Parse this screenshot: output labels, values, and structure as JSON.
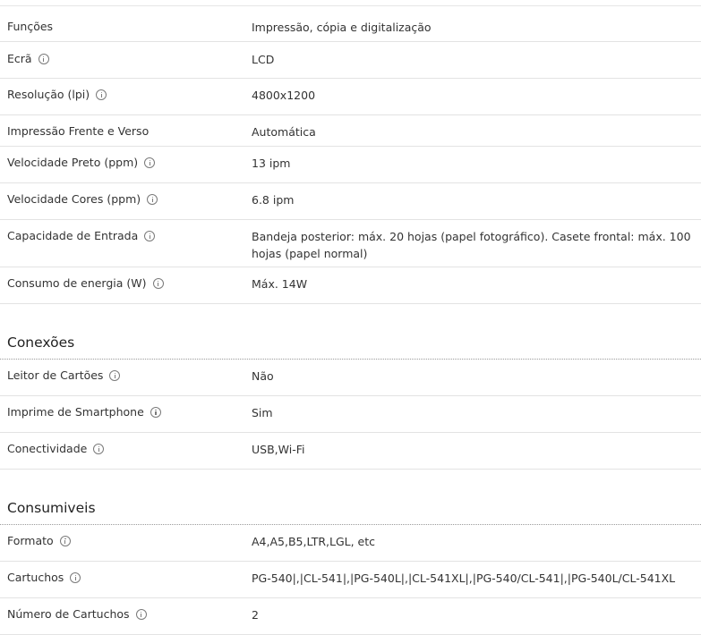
{
  "sections": [
    {
      "title": "",
      "rows": [
        {
          "label": "Funções",
          "value": "Impressão, cópia e digitalização",
          "info": false
        },
        {
          "label": "Ecrã",
          "value": "LCD",
          "info": true
        },
        {
          "label": "Resolução (lpi)",
          "value": "4800x1200",
          "info": true
        },
        {
          "label": "Impressão Frente e Verso",
          "value": "Automática",
          "info": false
        },
        {
          "label": "Velocidade Preto (ppm)",
          "value": "13 ipm",
          "info": true
        },
        {
          "label": "Velocidade Cores (ppm)",
          "value": "6.8 ipm",
          "info": true
        },
        {
          "label": "Capacidade de Entrada",
          "value": "Bandeja posterior: máx. 20 hojas (papel fotográfico). Casete frontal: máx. 100 hojas (papel normal)",
          "info": true
        },
        {
          "label": "Consumo de energia (W)",
          "value": "Máx. 14W",
          "info": true
        }
      ]
    },
    {
      "title": "Conexões",
      "rows": [
        {
          "label": "Leitor de Cartões",
          "value": "Não",
          "info": true
        },
        {
          "label": "Imprime de Smartphone",
          "value": "Sim",
          "info": true
        },
        {
          "label": "Conectividade",
          "value": "USB,Wi-Fi",
          "info": true
        }
      ]
    },
    {
      "title": "Consumiveis",
      "rows": [
        {
          "label": "Formato",
          "value": "A4,A5,B5,LTR,LGL, etc",
          "info": true
        },
        {
          "label": "Cartuchos",
          "value": "PG-540|,|CL-541|,|PG-540L|,|CL-541XL|,|PG-540/CL-541|,|PG-540L/CL-541XL",
          "info": true
        },
        {
          "label": "Número de Cartuchos",
          "value": "2",
          "info": true
        }
      ]
    }
  ],
  "icons": {
    "info": "info-circle-icon"
  },
  "colors": {
    "text": "#333333",
    "divider": "#e3e3e3",
    "section_rule": "#9a9a9a"
  }
}
